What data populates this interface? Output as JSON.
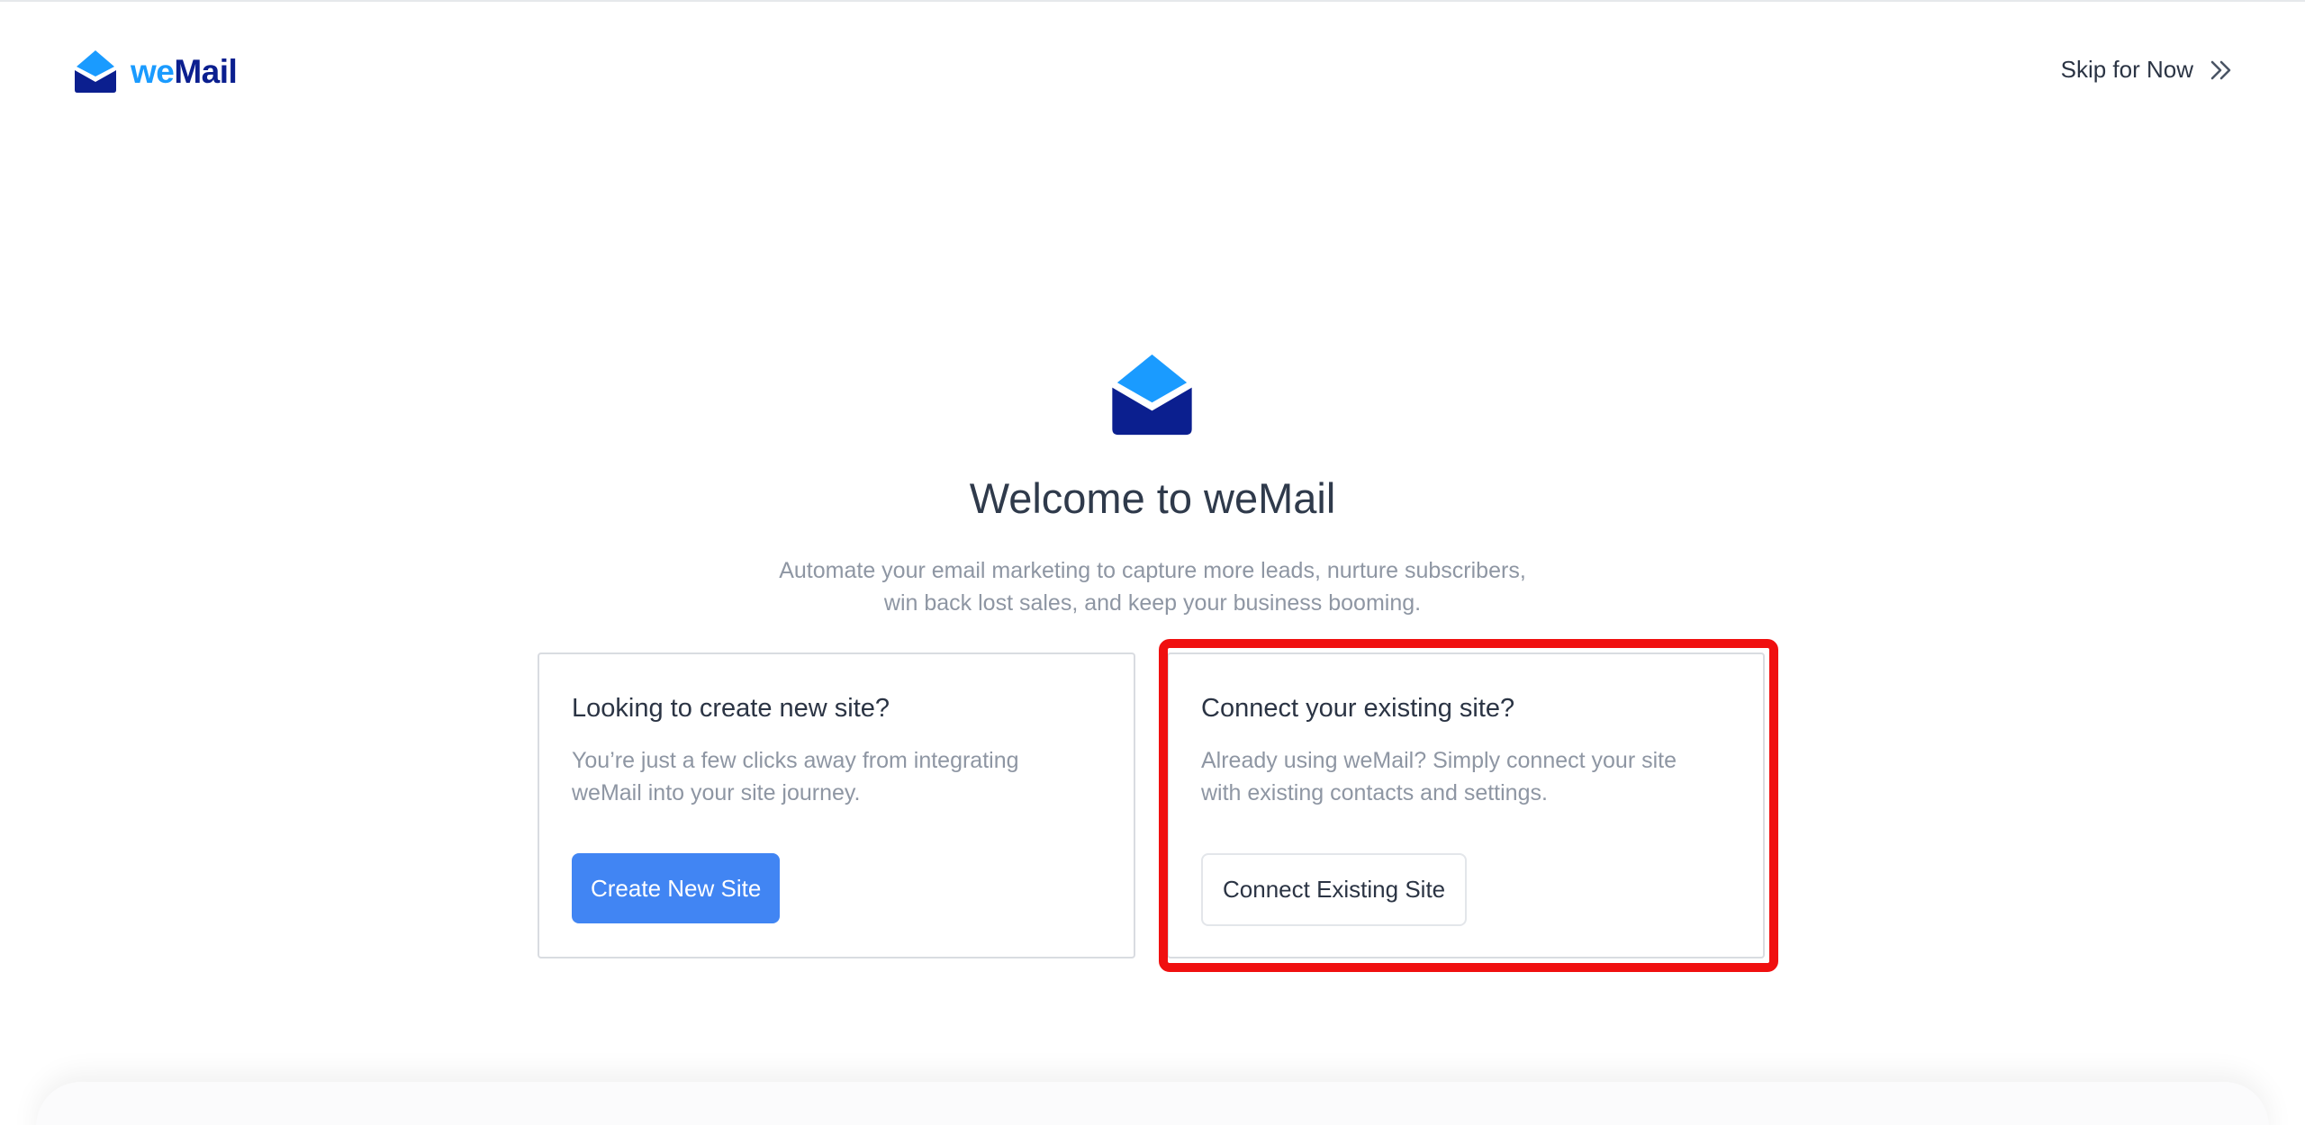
{
  "header": {
    "logo": {
      "text_we": "we",
      "text_mail": "Mail",
      "icon": "envelope-logo-icon"
    },
    "skip_label": "Skip for Now",
    "skip_icon": "double-chevron-right-icon"
  },
  "hero": {
    "icon": "envelope-open-icon",
    "title": "Welcome to weMail",
    "subtitle_line1": "Automate your email marketing to capture more leads, nurture subscribers,",
    "subtitle_line2": "win back lost sales, and keep your business booming."
  },
  "cards": [
    {
      "heading": "Looking to create new site?",
      "text_line1": "You’re just a few clicks away from integrating",
      "text_line2": "weMail into your site journey.",
      "button_label": "Create New Site"
    },
    {
      "heading": "Connect your existing site?",
      "text_line1": "Already using weMail? Simply connect your site",
      "text_line2": "with existing contacts and settings.",
      "button_label": "Connect Existing Site"
    }
  ],
  "colors": {
    "brand_light_blue": "#1a9bff",
    "brand_dark_blue": "#0b1f8f",
    "primary_button": "#4185f3",
    "highlight_border": "#f01010"
  }
}
